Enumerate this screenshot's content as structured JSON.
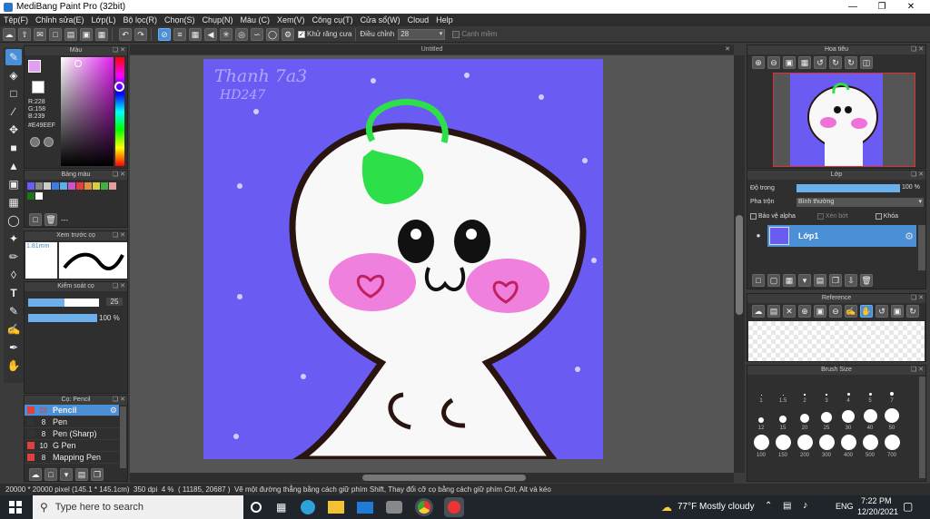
{
  "window": {
    "title": "MediBang Paint Pro (32bit)"
  },
  "menu": [
    "Tệp(F)",
    "Chỉnh sửa(E)",
    "Lớp(L)",
    "Bộ lọc(R)",
    "Chọn(S)",
    "Chụp(N)",
    "Màu (C)",
    "Xem(V)",
    "Công cụ(T)",
    "Cửa sổ(W)",
    "Cloud",
    "Help"
  ],
  "toolbar": {
    "antialias_label": "Khử răng cưa",
    "adjust_label": "Điều chỉnh",
    "adjust_value": "28",
    "soft_edge_label": "Cạnh mềm"
  },
  "color_panel": {
    "title": "Màu",
    "r": "R:228",
    "g": "G:158",
    "b": "B:239",
    "hex": "#E49EEF",
    "primary_color": "#E49EEF"
  },
  "palette_panel": {
    "title": "Bảng màu",
    "dash": "---"
  },
  "preview_panel": {
    "title": "Xem trước cọ",
    "size": "1.81mm"
  },
  "brush_control": {
    "title": "Kiểm soát cọ",
    "size_value": "25",
    "opacity_value": "100 %"
  },
  "brush_list": {
    "title": "Cọ: Pencil",
    "items": [
      {
        "size": "25",
        "name": "Pencil",
        "color": "#e04040"
      },
      {
        "size": "8",
        "name": "Pen",
        "color": "#333333"
      },
      {
        "size": "8",
        "name": "Pen (Sharp)",
        "color": "#333333"
      },
      {
        "size": "10",
        "name": "G Pen",
        "color": "#e04040"
      },
      {
        "size": "8",
        "name": "Mapping Pen",
        "color": "#e04040"
      }
    ]
  },
  "canvas": {
    "tab": "Untitled",
    "signature": "Thanh 7a3",
    "signature2": "HD247"
  },
  "navigator_panel": {
    "title": "Hoa tiêu"
  },
  "layer_panel": {
    "title": "Lớp",
    "opacity_label": "Độ trong",
    "opacity_value": "100 %",
    "blend_label": "Pha trộn",
    "blend_value": "Bình thường",
    "protect_alpha": "Bảo vệ alpha",
    "clipping": "Xén bớt",
    "lock": "Khóa",
    "layer_name": "Lớp1"
  },
  "reference_panel": {
    "title": "Reference"
  },
  "brush_size_panel": {
    "title": "Brush Size",
    "row1": [
      "1",
      "1.5",
      "2",
      "3",
      "4",
      "5",
      "7"
    ],
    "row2": [
      "12",
      "15",
      "20",
      "25",
      "30",
      "40",
      "50"
    ],
    "row3": [
      "100",
      "150",
      "200",
      "300",
      "400",
      "500",
      "700"
    ]
  },
  "status": {
    "dims": "20000 * 20000 pixel",
    "cm": "(145.1 * 145.1cm)",
    "dpi": "350 dpi",
    "zoom": "4 %",
    "coords": "( 11185, 20687 )",
    "hint": "Vẽ một đường thẳng bằng cách giữ phím Shift, Thay đổi cỡ cọ bằng cách giữ phím Ctrl, Alt và kéo"
  },
  "taskbar": {
    "search_placeholder": "Type here to search",
    "weather": "77°F  Mostly cloudy",
    "lang": "ENG",
    "time": "7:22 PM",
    "date": "12/20/2021"
  }
}
